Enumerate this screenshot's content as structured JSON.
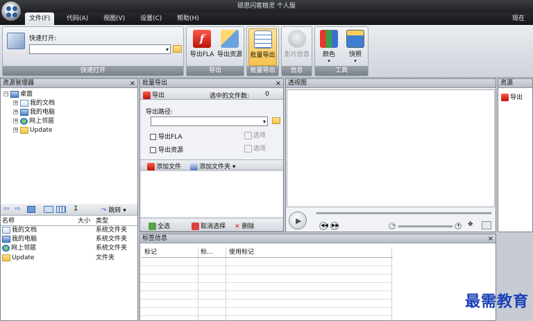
{
  "window": {
    "title": "硕思闪客精灵 个人版"
  },
  "menu": {
    "tabs": [
      "文件(F)",
      "代码(A)",
      "视图(V)",
      "设置(C)",
      "帮助(H)"
    ],
    "right_text": "现在注"
  },
  "ribbon": {
    "quick_open": {
      "label": "快速打开:",
      "group": "快速打开"
    },
    "export": {
      "fla": "导出FLA",
      "res": "导出资源",
      "group": "导出"
    },
    "batch": {
      "btn": "批量导出",
      "group": "批量导出"
    },
    "info": {
      "btn": "影片信息",
      "group": "信息"
    },
    "tools": {
      "color": "颜色",
      "snapshot": "快照",
      "group": "工具"
    }
  },
  "explorer": {
    "title": "资源管理器",
    "tree_root": "桌面",
    "tree": [
      "我的文档",
      "我的电脑",
      "网上邻居",
      "Update"
    ],
    "jump": "跳转",
    "columns": [
      "名称",
      "大小",
      "类型"
    ],
    "files": [
      {
        "name": "我的文档",
        "size": "",
        "type": "系统文件夹"
      },
      {
        "name": "我的电脑",
        "size": "",
        "type": "系统文件夹"
      },
      {
        "name": "网上邻居",
        "size": "",
        "type": "系统文件夹"
      },
      {
        "name": "Update",
        "size": "",
        "type": "文件夹"
      }
    ]
  },
  "batch_export": {
    "title": "批量导出",
    "export_label": "导出",
    "selected_label": "选中的文件数:",
    "selected_count": "0",
    "path_label": "导出路径:",
    "export_fla": "导出FLA",
    "export_res": "导出资源",
    "option": "选项",
    "add_file": "添加文件",
    "add_folder": "添加文件夹",
    "select_all": "全选",
    "deselect": "取消选择",
    "delete": "删除"
  },
  "preview": {
    "title": "透视图"
  },
  "resources": {
    "title": "资源",
    "export_label": "导出"
  },
  "tag_info": {
    "title": "标签信息",
    "columns": [
      "标记",
      "标...",
      "使用标记"
    ]
  },
  "watermark": "最需教育"
}
